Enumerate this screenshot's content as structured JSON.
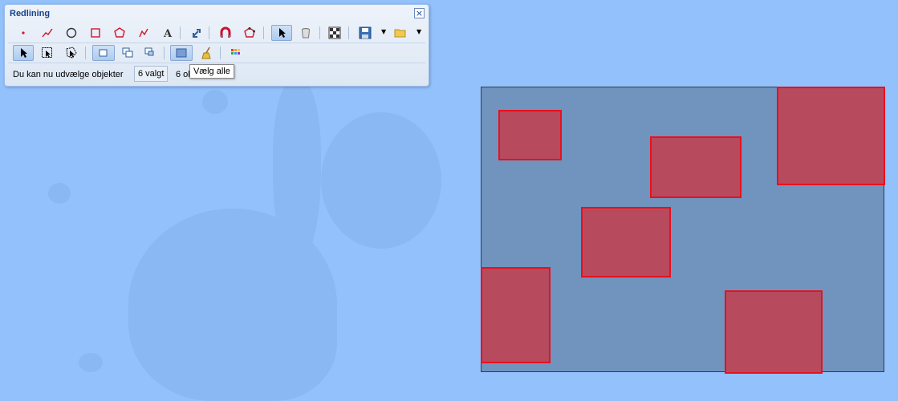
{
  "panel": {
    "title": "Redlining",
    "close_label": "×"
  },
  "toolbar": {
    "row1_icons": [
      "point-icon",
      "line-icon",
      "circle-icon",
      "rectangle-icon",
      "polygon-icon",
      "freehand-icon",
      "text-icon",
      "move-icon",
      "snap-magnet-icon",
      "edit-polygon-icon",
      "select-arrow-icon",
      "delete-bucket-icon",
      "grid-icon",
      "save-icon",
      "open-folder-icon"
    ],
    "row2_icons": [
      "select-icon",
      "box-select-icon",
      "lasso-select-icon",
      "union-mode-icon",
      "add-mode-icon",
      "subtract-mode-icon",
      "select-all-icon",
      "broom-icon",
      "style-icon"
    ]
  },
  "status": {
    "message": "Du kan nu udvælge objekter",
    "selected_count": "6 valgt",
    "objects_count": "6 ob"
  },
  "tooltip": {
    "text": "Vælg alle"
  }
}
